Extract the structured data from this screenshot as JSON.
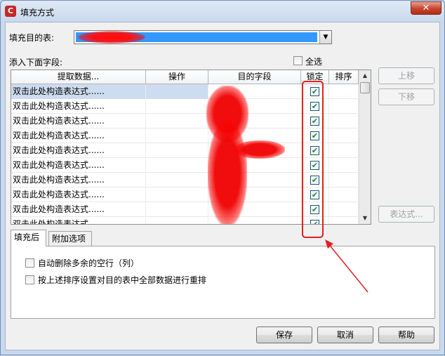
{
  "window": {
    "title": "填充方式",
    "icon": "app-logo-icon",
    "close_glyph": "✕"
  },
  "target_table": {
    "label": "填充目的表:",
    "selected_value_redacted": true,
    "arrow_glyph": "▼"
  },
  "fields_section": {
    "label": "添入下面字段:",
    "select_all_label": "全选",
    "select_all_checked": false
  },
  "grid": {
    "columns": [
      "提取数据...",
      "操作",
      "目的字段",
      "锁定",
      "排序"
    ],
    "rows": [
      {
        "expr": "双击此处构造表达式......",
        "locked": true,
        "selected": true
      },
      {
        "expr": "双击此处构造表达式......",
        "locked": true
      },
      {
        "expr": "双击此处构造表达式......",
        "locked": true
      },
      {
        "expr": "双击此处构造表达式......",
        "locked": true
      },
      {
        "expr": "双击此处构造表达式......",
        "locked": true
      },
      {
        "expr": "双击此处构造表达式......",
        "locked": true
      },
      {
        "expr": "双击此处构造表达式......",
        "locked": true
      },
      {
        "expr": "双击此处构造表达式......",
        "locked": true
      },
      {
        "expr": "双击此处构造表达式......",
        "locked": true
      },
      {
        "expr": "双击此处构造表达式......",
        "locked": true
      }
    ],
    "check_glyph": "✔",
    "scroll_up_glyph": "▲",
    "scroll_down_glyph": "▼"
  },
  "side_buttons": {
    "up": "上移",
    "down": "下移",
    "expression": "表达式..."
  },
  "tabs": [
    {
      "label": "填充后"
    },
    {
      "label": "附加选项"
    }
  ],
  "options": [
    {
      "label": "自动删除多余的空行（列）",
      "checked": false
    },
    {
      "label": "按上述排序设置对目的表中全部数据进行重排",
      "checked": false
    }
  ],
  "footer": {
    "save": "保存",
    "cancel": "取消",
    "help": "帮助"
  },
  "colors": {
    "redaction": "#ff0000",
    "annotation": "#e02020",
    "selection": "#3399ff"
  }
}
